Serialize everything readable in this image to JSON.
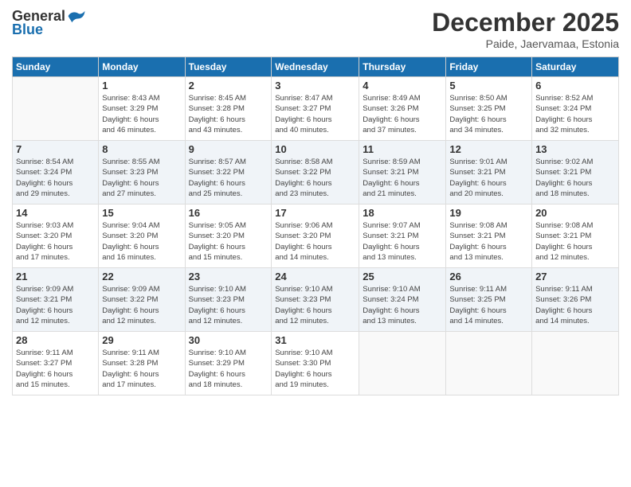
{
  "header": {
    "logo_general": "General",
    "logo_blue": "Blue",
    "month": "December 2025",
    "location": "Paide, Jaervamaa, Estonia"
  },
  "weekdays": [
    "Sunday",
    "Monday",
    "Tuesday",
    "Wednesday",
    "Thursday",
    "Friday",
    "Saturday"
  ],
  "weeks": [
    [
      {
        "day": "",
        "info": ""
      },
      {
        "day": "1",
        "info": "Sunrise: 8:43 AM\nSunset: 3:29 PM\nDaylight: 6 hours\nand 46 minutes."
      },
      {
        "day": "2",
        "info": "Sunrise: 8:45 AM\nSunset: 3:28 PM\nDaylight: 6 hours\nand 43 minutes."
      },
      {
        "day": "3",
        "info": "Sunrise: 8:47 AM\nSunset: 3:27 PM\nDaylight: 6 hours\nand 40 minutes."
      },
      {
        "day": "4",
        "info": "Sunrise: 8:49 AM\nSunset: 3:26 PM\nDaylight: 6 hours\nand 37 minutes."
      },
      {
        "day": "5",
        "info": "Sunrise: 8:50 AM\nSunset: 3:25 PM\nDaylight: 6 hours\nand 34 minutes."
      },
      {
        "day": "6",
        "info": "Sunrise: 8:52 AM\nSunset: 3:24 PM\nDaylight: 6 hours\nand 32 minutes."
      }
    ],
    [
      {
        "day": "7",
        "info": "Sunrise: 8:54 AM\nSunset: 3:24 PM\nDaylight: 6 hours\nand 29 minutes."
      },
      {
        "day": "8",
        "info": "Sunrise: 8:55 AM\nSunset: 3:23 PM\nDaylight: 6 hours\nand 27 minutes."
      },
      {
        "day": "9",
        "info": "Sunrise: 8:57 AM\nSunset: 3:22 PM\nDaylight: 6 hours\nand 25 minutes."
      },
      {
        "day": "10",
        "info": "Sunrise: 8:58 AM\nSunset: 3:22 PM\nDaylight: 6 hours\nand 23 minutes."
      },
      {
        "day": "11",
        "info": "Sunrise: 8:59 AM\nSunset: 3:21 PM\nDaylight: 6 hours\nand 21 minutes."
      },
      {
        "day": "12",
        "info": "Sunrise: 9:01 AM\nSunset: 3:21 PM\nDaylight: 6 hours\nand 20 minutes."
      },
      {
        "day": "13",
        "info": "Sunrise: 9:02 AM\nSunset: 3:21 PM\nDaylight: 6 hours\nand 18 minutes."
      }
    ],
    [
      {
        "day": "14",
        "info": "Sunrise: 9:03 AM\nSunset: 3:20 PM\nDaylight: 6 hours\nand 17 minutes."
      },
      {
        "day": "15",
        "info": "Sunrise: 9:04 AM\nSunset: 3:20 PM\nDaylight: 6 hours\nand 16 minutes."
      },
      {
        "day": "16",
        "info": "Sunrise: 9:05 AM\nSunset: 3:20 PM\nDaylight: 6 hours\nand 15 minutes."
      },
      {
        "day": "17",
        "info": "Sunrise: 9:06 AM\nSunset: 3:20 PM\nDaylight: 6 hours\nand 14 minutes."
      },
      {
        "day": "18",
        "info": "Sunrise: 9:07 AM\nSunset: 3:21 PM\nDaylight: 6 hours\nand 13 minutes."
      },
      {
        "day": "19",
        "info": "Sunrise: 9:08 AM\nSunset: 3:21 PM\nDaylight: 6 hours\nand 13 minutes."
      },
      {
        "day": "20",
        "info": "Sunrise: 9:08 AM\nSunset: 3:21 PM\nDaylight: 6 hours\nand 12 minutes."
      }
    ],
    [
      {
        "day": "21",
        "info": "Sunrise: 9:09 AM\nSunset: 3:21 PM\nDaylight: 6 hours\nand 12 minutes."
      },
      {
        "day": "22",
        "info": "Sunrise: 9:09 AM\nSunset: 3:22 PM\nDaylight: 6 hours\nand 12 minutes."
      },
      {
        "day": "23",
        "info": "Sunrise: 9:10 AM\nSunset: 3:23 PM\nDaylight: 6 hours\nand 12 minutes."
      },
      {
        "day": "24",
        "info": "Sunrise: 9:10 AM\nSunset: 3:23 PM\nDaylight: 6 hours\nand 12 minutes."
      },
      {
        "day": "25",
        "info": "Sunrise: 9:10 AM\nSunset: 3:24 PM\nDaylight: 6 hours\nand 13 minutes."
      },
      {
        "day": "26",
        "info": "Sunrise: 9:11 AM\nSunset: 3:25 PM\nDaylight: 6 hours\nand 14 minutes."
      },
      {
        "day": "27",
        "info": "Sunrise: 9:11 AM\nSunset: 3:26 PM\nDaylight: 6 hours\nand 14 minutes."
      }
    ],
    [
      {
        "day": "28",
        "info": "Sunrise: 9:11 AM\nSunset: 3:27 PM\nDaylight: 6 hours\nand 15 minutes."
      },
      {
        "day": "29",
        "info": "Sunrise: 9:11 AM\nSunset: 3:28 PM\nDaylight: 6 hours\nand 17 minutes."
      },
      {
        "day": "30",
        "info": "Sunrise: 9:10 AM\nSunset: 3:29 PM\nDaylight: 6 hours\nand 18 minutes."
      },
      {
        "day": "31",
        "info": "Sunrise: 9:10 AM\nSunset: 3:30 PM\nDaylight: 6 hours\nand 19 minutes."
      },
      {
        "day": "",
        "info": ""
      },
      {
        "day": "",
        "info": ""
      },
      {
        "day": "",
        "info": ""
      }
    ]
  ]
}
